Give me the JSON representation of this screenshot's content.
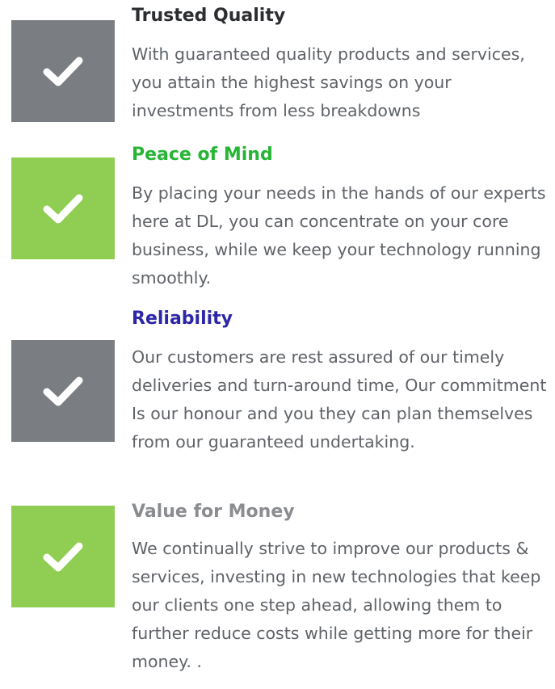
{
  "colors": {
    "gray_box": "#7a7d81",
    "green_box": "#8fce52",
    "check": "#ffffff",
    "body_text": "#5f6368"
  },
  "features": [
    {
      "title": "Trusted Quality",
      "title_color": "#2b2d31",
      "box_color": "#7a7d81",
      "icon": "checkmark-icon",
      "text": "With guaranteed quality products and services, you attain the highest savings on your investments from less breakdowns"
    },
    {
      "title": "Peace of Mind",
      "title_color": "#26b535",
      "box_color": "#8fce52",
      "icon": "checkmark-icon",
      "text": "By placing your needs in the hands of our experts here at DL, you can concentrate on your core business, while we keep your technology running smoothly."
    },
    {
      "title": "Reliability",
      "title_color": "#2c26a8",
      "box_color": "#7a7d81",
      "icon": "checkmark-icon",
      "text": "Our customers are rest assured of our timely deliveries and turn-around time, Our commitment Is our honour and you they can plan themselves from our guaranteed undertaking."
    },
    {
      "title": "Value for Money",
      "title_color": "#8a8c90",
      "box_color": "#8fce52",
      "icon": "checkmark-icon",
      "text": "We continually strive to improve our products & services, investing in new technologies that keep our clients one step ahead, allowing them to further reduce costs while  getting more for their money. ."
    }
  ]
}
